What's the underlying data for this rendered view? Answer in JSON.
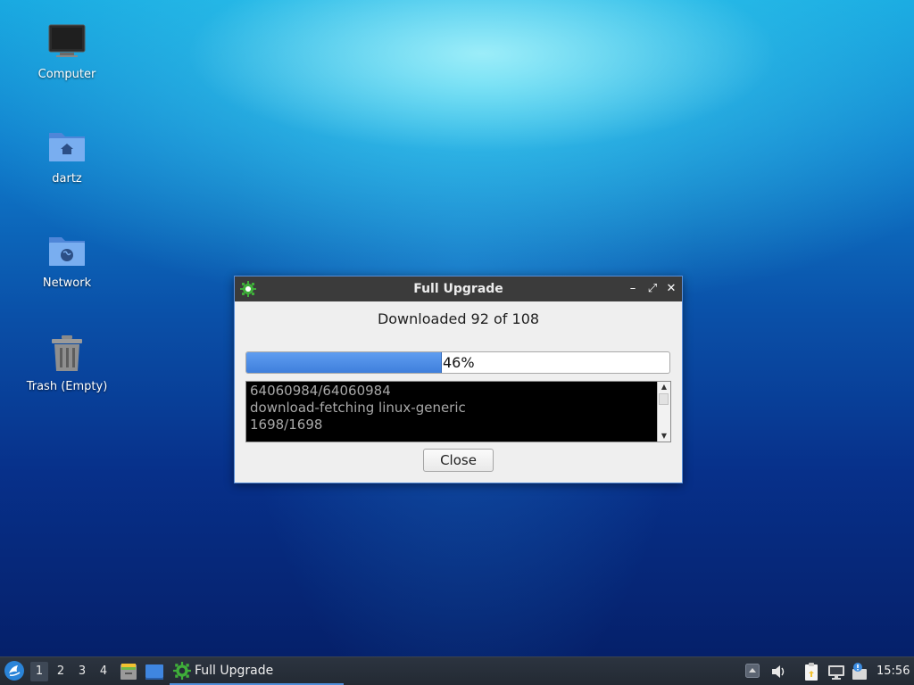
{
  "desktop": {
    "icons": [
      {
        "label": "Computer",
        "icon": "monitor-icon"
      },
      {
        "label": "dartz",
        "icon": "home-folder-icon"
      },
      {
        "label": "Network",
        "icon": "network-folder-icon"
      },
      {
        "label": "Trash (Empty)",
        "icon": "trash-icon"
      }
    ]
  },
  "dialog": {
    "title": "Full Upgrade",
    "app_icon": "gear-icon",
    "headline": "Downloaded 92 of 108",
    "progress": {
      "percent": 46,
      "label": "46%"
    },
    "log_lines": [
      "64060984/64060984",
      "download-fetching linux-generic",
      "1698/1698"
    ],
    "close_button": "Close",
    "window_controls": {
      "minimize": "–",
      "maximize": "⤢",
      "close": "✕"
    }
  },
  "taskbar": {
    "workspaces": [
      "1",
      "2",
      "3",
      "4"
    ],
    "active_workspace": "1",
    "task": {
      "label": "Full Upgrade",
      "icon": "gear-icon"
    },
    "clock": "15:56"
  },
  "colors": {
    "titlebar": "#3b3b3b",
    "progress_fill": "#4a8ae6",
    "log_background": "#000000",
    "taskbar": "#262d37"
  }
}
